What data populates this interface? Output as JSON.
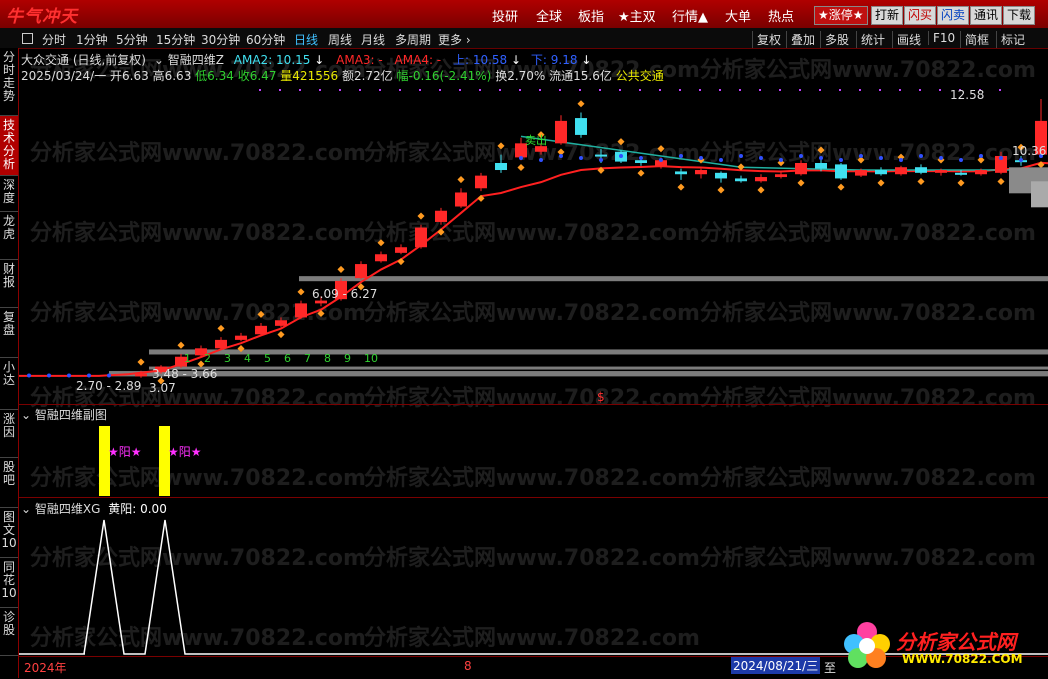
{
  "app": {
    "logo": "牛气冲天"
  },
  "top_nav": [
    "投研",
    "全球",
    "板指",
    "★主双",
    "行情▲",
    "大单",
    "热点"
  ],
  "top_buttons": [
    "★涨停★",
    "打新",
    "闪买",
    "闪卖",
    "通讯",
    "下载"
  ],
  "period_tabs": [
    "分时",
    "1分钟",
    "5分钟",
    "15分钟",
    "30分钟",
    "60分钟",
    "日线",
    "周线",
    "月线",
    "多周期",
    "更多 ›"
  ],
  "active_period": "日线",
  "right_tools": [
    "复权",
    "叠加",
    "多股",
    "统计",
    "画线",
    "F10",
    "简框",
    "标记"
  ],
  "sidebar": [
    "分时走势",
    "技术分析",
    "深度",
    "龙虎",
    "财报",
    "复盘",
    "小达",
    "涨因",
    "股吧",
    "图文10",
    "同花10",
    "诊股"
  ],
  "active_sidebar": "技术分析",
  "main_panel": {
    "stock_title": "大众交通 (日线,前复权)",
    "indicator_name": "智融四维Z",
    "ama2": "AMA2: 10.15",
    "ama3": "AMA3: -",
    "ama4": "AMA4: -",
    "up": "上: 10.58",
    "down": "下: 9.18",
    "date": "2025/03/24/一",
    "open": "开6.63",
    "high": "高6.63",
    "low": "低6.34",
    "close": "收6.47",
    "volume": "量421556",
    "amount": "额2.72亿",
    "change": "幅-0.16(-2.41%)",
    "turnover": "换2.70%",
    "float_cap": "流通15.6亿",
    "sector": "公共交通",
    "price_high_label": "12.58",
    "price_right_label": "10.36",
    "zone_labels": [
      "6.09 - 6.27",
      "3.48 - 3.66",
      "2.70 - 2.89",
      "3.07"
    ],
    "count_labels": [
      "1",
      "2",
      "3",
      "4",
      "5",
      "6",
      "7",
      "8",
      "9",
      "10"
    ],
    "signal_label": "卖出",
    "dollar_mark": "$"
  },
  "sub_panel1": {
    "title": "智融四维副图",
    "signal_label": "★阳★"
  },
  "sub_panel2": {
    "title": "智融四维XG",
    "value_label": "黄阳: 0.00"
  },
  "axis": {
    "year": "2024年",
    "month": "8",
    "date_cursor": "2024/08/21/三",
    "extra": "至"
  },
  "watermark": "分析家公式网www.70822.com",
  "brand": {
    "name": "分析家公式网",
    "url": "WWW.70822.COM"
  },
  "colors": {
    "up": "#ff2828",
    "down": "#40e0f0",
    "ma_line": "#ff2020",
    "teal_line": "#20b0a0",
    "accent": "#ff5a00"
  },
  "chart_data": {
    "type": "candlestick",
    "candles": [
      {
        "o": 2.7,
        "c": 2.8,
        "h": 2.9,
        "l": 2.65
      },
      {
        "o": 2.85,
        "c": 3.05,
        "h": 3.1,
        "l": 2.8
      },
      {
        "o": 3.05,
        "c": 3.4,
        "h": 3.5,
        "l": 3.0
      },
      {
        "o": 3.45,
        "c": 3.7,
        "h": 3.8,
        "l": 3.4
      },
      {
        "o": 3.7,
        "c": 4.0,
        "h": 4.1,
        "l": 3.65
      },
      {
        "o": 4.0,
        "c": 4.15,
        "h": 4.25,
        "l": 3.95
      },
      {
        "o": 4.2,
        "c": 4.5,
        "h": 4.6,
        "l": 4.15
      },
      {
        "o": 4.5,
        "c": 4.7,
        "h": 4.8,
        "l": 4.45
      },
      {
        "o": 4.8,
        "c": 5.3,
        "h": 5.4,
        "l": 4.75
      },
      {
        "o": 5.3,
        "c": 5.4,
        "h": 5.55,
        "l": 5.2
      },
      {
        "o": 5.45,
        "c": 6.1,
        "h": 6.2,
        "l": 5.4
      },
      {
        "o": 6.2,
        "c": 6.7,
        "h": 6.8,
        "l": 6.15
      },
      {
        "o": 6.8,
        "c": 7.05,
        "h": 7.15,
        "l": 6.75
      },
      {
        "o": 7.1,
        "c": 7.3,
        "h": 7.4,
        "l": 7.05
      },
      {
        "o": 7.3,
        "c": 8.0,
        "h": 8.1,
        "l": 7.25
      },
      {
        "o": 8.2,
        "c": 8.6,
        "h": 8.7,
        "l": 8.1
      },
      {
        "o": 8.75,
        "c": 9.25,
        "h": 9.4,
        "l": 8.7
      },
      {
        "o": 9.4,
        "c": 9.85,
        "h": 9.95,
        "l": 9.3
      },
      {
        "o": 10.3,
        "c": 10.05,
        "h": 10.6,
        "l": 9.95
      },
      {
        "o": 10.5,
        "c": 11.0,
        "h": 11.2,
        "l": 10.4
      },
      {
        "o": 10.7,
        "c": 10.9,
        "h": 11.0,
        "l": 10.6
      },
      {
        "o": 11.0,
        "c": 11.8,
        "h": 12.0,
        "l": 10.95
      },
      {
        "o": 11.9,
        "c": 11.3,
        "h": 12.1,
        "l": 11.2
      },
      {
        "o": 10.6,
        "c": 10.55,
        "h": 10.8,
        "l": 10.3
      },
      {
        "o": 10.7,
        "c": 10.35,
        "h": 10.75,
        "l": 10.3
      },
      {
        "o": 10.4,
        "c": 10.3,
        "h": 10.5,
        "l": 10.2
      },
      {
        "o": 10.2,
        "c": 10.4,
        "h": 10.5,
        "l": 10.1
      },
      {
        "o": 10.0,
        "c": 9.9,
        "h": 10.1,
        "l": 9.7
      },
      {
        "o": 9.9,
        "c": 10.05,
        "h": 10.1,
        "l": 9.75
      },
      {
        "o": 9.95,
        "c": 9.75,
        "h": 10.0,
        "l": 9.6
      },
      {
        "o": 9.75,
        "c": 9.65,
        "h": 9.85,
        "l": 9.6
      },
      {
        "o": 9.65,
        "c": 9.8,
        "h": 9.9,
        "l": 9.6
      },
      {
        "o": 9.8,
        "c": 9.9,
        "h": 10.0,
        "l": 9.75
      },
      {
        "o": 9.9,
        "c": 10.3,
        "h": 10.4,
        "l": 9.85
      },
      {
        "o": 10.3,
        "c": 10.1,
        "h": 10.45,
        "l": 10.0
      },
      {
        "o": 10.25,
        "c": 9.75,
        "h": 10.3,
        "l": 9.7
      },
      {
        "o": 9.85,
        "c": 10.05,
        "h": 10.1,
        "l": 9.8
      },
      {
        "o": 10.05,
        "c": 9.9,
        "h": 10.15,
        "l": 9.85
      },
      {
        "o": 9.9,
        "c": 10.15,
        "h": 10.2,
        "l": 9.85
      },
      {
        "o": 10.15,
        "c": 9.95,
        "h": 10.25,
        "l": 9.9
      },
      {
        "o": 9.95,
        "c": 10.05,
        "h": 10.1,
        "l": 9.85
      },
      {
        "o": 9.95,
        "c": 9.9,
        "h": 10.05,
        "l": 9.85
      },
      {
        "o": 9.9,
        "c": 10.05,
        "h": 10.1,
        "l": 9.85
      },
      {
        "o": 9.95,
        "c": 10.55,
        "h": 10.7,
        "l": 9.9
      },
      {
        "o": 10.4,
        "c": 10.35,
        "h": 10.55,
        "l": 10.2
      },
      {
        "o": 10.6,
        "c": 11.8,
        "h": 12.58,
        "l": 10.5
      },
      {
        "o": 10.2,
        "c": 9.9,
        "h": 10.3,
        "l": 9.6
      }
    ],
    "ylim": [
      2.5,
      12.9
    ],
    "sub1_bars_at": [
      4,
      7
    ],
    "sub2_peaks_at": [
      4,
      7
    ]
  }
}
